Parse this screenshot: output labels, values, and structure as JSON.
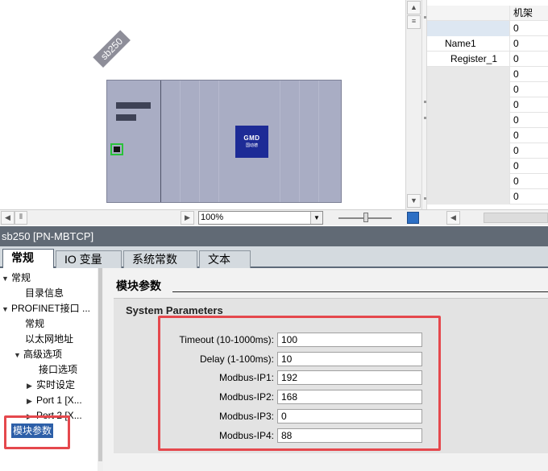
{
  "device": {
    "name_tag": "sb250",
    "logo_text": "GMD",
    "logo_sub": "国动德"
  },
  "table": {
    "header": "机架",
    "rows": [
      {
        "name": "",
        "value": "0"
      },
      {
        "name": "Name1",
        "value": "0"
      },
      {
        "name": "Register_1",
        "value": "0"
      },
      {
        "name": "",
        "value": "0"
      },
      {
        "name": "",
        "value": "0"
      },
      {
        "name": "",
        "value": "0"
      },
      {
        "name": "",
        "value": "0"
      },
      {
        "name": "",
        "value": "0"
      },
      {
        "name": "",
        "value": "0"
      },
      {
        "name": "",
        "value": "0"
      },
      {
        "name": "",
        "value": "0"
      },
      {
        "name": "",
        "value": "0"
      }
    ]
  },
  "toolbar": {
    "zoom": "100%"
  },
  "inspector": {
    "title": "sb250 [PN-MBTCP]",
    "tabs": [
      "常规",
      "IO 变量",
      "系统常数",
      "文本"
    ],
    "nav": {
      "general": "常规",
      "catalog": "目录信息",
      "profinet": "PROFINET接口 ...",
      "pn_general": "常规",
      "ethernet": "以太网地址",
      "advanced": "高级选项",
      "iface_options": "接口选项",
      "realtime": "实时设定",
      "port1": "Port 1 [X...",
      "port2": "Port 2 [X...",
      "module_params": "模块参数"
    },
    "section_title": "模块参数",
    "panel_title": "System Parameters",
    "params": [
      {
        "label": "Timeout (10-1000ms):",
        "value": "100"
      },
      {
        "label": "Delay (1-100ms):",
        "value": "10"
      },
      {
        "label": "Modbus-IP1:",
        "value": "192"
      },
      {
        "label": "Modbus-IP2:",
        "value": "168"
      },
      {
        "label": "Modbus-IP3:",
        "value": "0"
      },
      {
        "label": "Modbus-IP4:",
        "value": "88"
      }
    ]
  },
  "colors": {
    "title_bar": "#616a75",
    "highlight_box": "#e5484d",
    "selected_nav": "#2d5fa8",
    "logo_bg": "#1d2b96"
  }
}
